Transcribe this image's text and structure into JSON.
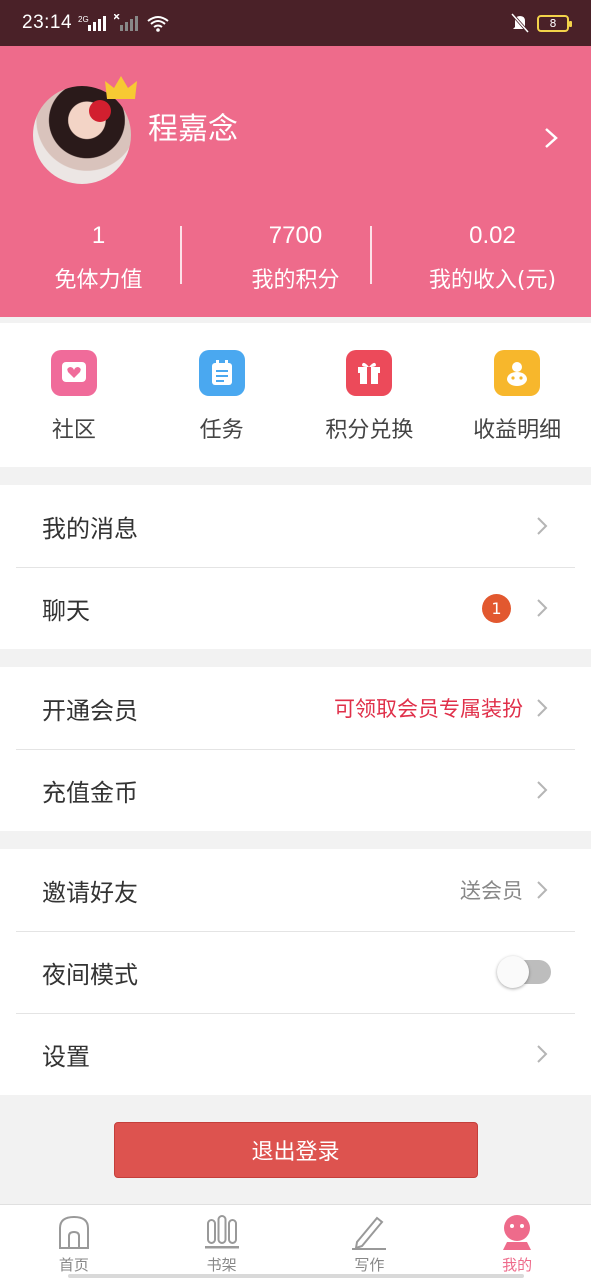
{
  "status": {
    "time": "23:14",
    "network": "2G",
    "battery": "8"
  },
  "profile": {
    "name": "程嘉念"
  },
  "stats": [
    {
      "value": "1",
      "label": "免体力值"
    },
    {
      "value": "7700",
      "label": "我的积分"
    },
    {
      "value": "0.02",
      "label": "我的收入(元)"
    }
  ],
  "quick": [
    {
      "label": "社区",
      "icon": "community-icon",
      "color": "#f06b9a"
    },
    {
      "label": "任务",
      "icon": "task-icon",
      "color": "#4aa8f0"
    },
    {
      "label": "积分兑换",
      "icon": "gift-icon",
      "color": "#ec4a5a"
    },
    {
      "label": "收益明细",
      "icon": "earnings-icon",
      "color": "#f7b72c"
    }
  ],
  "menu": {
    "messages": "我的消息",
    "chat": "聊天",
    "chat_badge": "1",
    "vip": "开通会员",
    "vip_hint": "可领取会员专属装扮",
    "recharge": "充值金币",
    "invite": "邀请好友",
    "invite_hint": "送会员",
    "night_mode": "夜间模式",
    "night_mode_on": false,
    "settings": "设置"
  },
  "logout": "退出登录",
  "tabs": [
    {
      "label": "首页",
      "icon": "home-icon"
    },
    {
      "label": "书架",
      "icon": "bookshelf-icon"
    },
    {
      "label": "写作",
      "icon": "pen-icon"
    },
    {
      "label": "我的",
      "icon": "profile-icon",
      "active": true
    }
  ],
  "colors": {
    "brand": "#ee6b8b",
    "statusbar": "#4a2128",
    "logout": "#dd534f",
    "badge": "#e2582f"
  }
}
